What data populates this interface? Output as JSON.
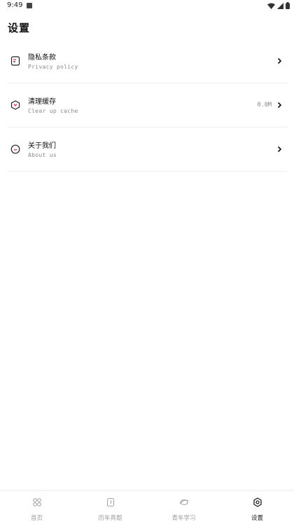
{
  "status_bar": {
    "time": "9:49",
    "icons": [
      "notification-icon",
      "wifi-icon",
      "signal-icon",
      "battery-icon"
    ]
  },
  "page": {
    "title": "设置"
  },
  "settings": {
    "items": [
      {
        "icon": "document-icon",
        "title": "隐私条款",
        "subtitle": "Privacy policy",
        "value": ""
      },
      {
        "icon": "hexagon-clean-icon",
        "title": "清理缓存",
        "subtitle": "Clear up cache",
        "value": "0.0M"
      },
      {
        "icon": "smile-circle-icon",
        "title": "关于我们",
        "subtitle": "About us",
        "value": ""
      }
    ]
  },
  "tab_bar": {
    "tabs": [
      {
        "label": "首页",
        "icon": "grid-icon",
        "active": false
      },
      {
        "label": "历年真题",
        "icon": "book-icon",
        "active": false
      },
      {
        "label": "青年学习",
        "icon": "eye-icon",
        "active": false
      },
      {
        "label": "设置",
        "icon": "gear-icon",
        "active": true
      }
    ]
  },
  "colors": {
    "accent": "#e0245e",
    "text": "#111111",
    "muted": "#8a8a8a"
  }
}
